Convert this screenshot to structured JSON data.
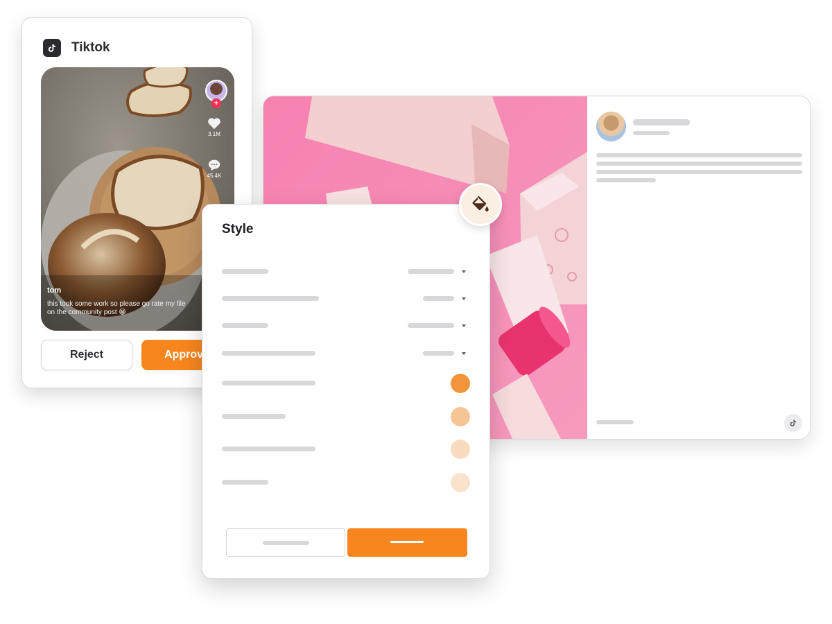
{
  "tiktok_card": {
    "platform": "Tiktok",
    "icon": "tiktok-icon",
    "post": {
      "username": "tom",
      "caption": "this took some work so please go rate my file on the community post 😁",
      "likes": "3.1M",
      "comments": "45.4K"
    },
    "reject_label": "Reject",
    "approve_label": "Approv"
  },
  "style_panel": {
    "title": "Style",
    "icon": "paint-bucket-icon",
    "swatch_colors": [
      "#f2943a",
      "#f6c596",
      "#f9dbc0",
      "#fae3cc"
    ]
  },
  "post_preview": {
    "platform_icon": "tiktok-icon"
  },
  "colors": {
    "accent": "#f7861f",
    "pink": "#f78bb4"
  }
}
